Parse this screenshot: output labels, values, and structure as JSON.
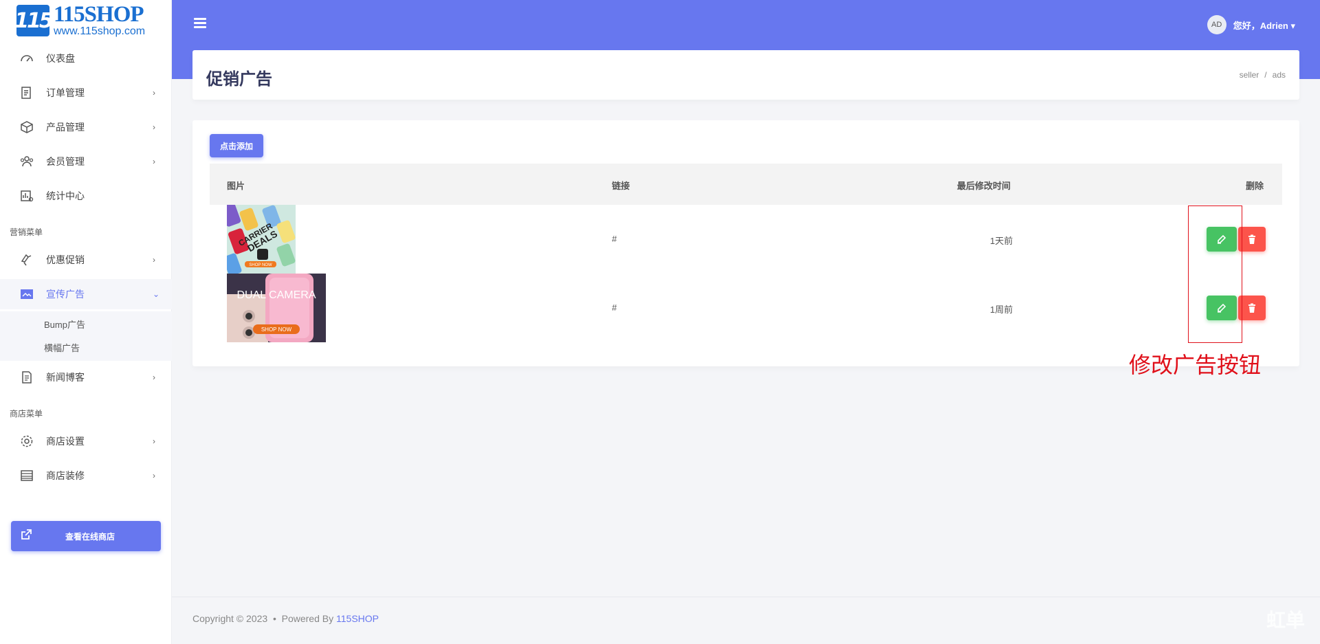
{
  "logo": {
    "name": "115SHOP",
    "url": "www.115shop.com",
    "mark": "115"
  },
  "sidebar": {
    "items": [
      {
        "label": "仪表盘",
        "icon": "dashboard-icon"
      },
      {
        "label": "订单管理",
        "icon": "orders-icon"
      },
      {
        "label": "产品管理",
        "icon": "products-icon"
      },
      {
        "label": "会员管理",
        "icon": "members-icon"
      },
      {
        "label": "统计中心",
        "icon": "stats-icon"
      },
      {
        "label": "优惠促销",
        "icon": "promotion-icon"
      },
      {
        "label": "宣传广告",
        "icon": "ads-icon"
      },
      {
        "label": "新闻博客",
        "icon": "news-icon"
      },
      {
        "label": "商店设置",
        "icon": "settings-icon"
      },
      {
        "label": "商店装修",
        "icon": "decoration-icon"
      }
    ],
    "sections": {
      "marketing": "营销菜单",
      "shop": "商店菜单"
    },
    "ads_sub": [
      "Bump广告",
      "横幅广告"
    ],
    "visit_store": "查看在线商店",
    "chevron": "›",
    "chevron_down": "⌄"
  },
  "header": {
    "avatar": "AD",
    "greeting": "您好，Adrien ▾"
  },
  "page": {
    "title": "促销广告",
    "breadcrumb": [
      "seller",
      "ads"
    ],
    "breadcrumb_sep": "/"
  },
  "table": {
    "add_button": "点击添加",
    "columns": [
      "图片",
      "链接",
      "最后修改时间",
      "删除"
    ],
    "rows": [
      {
        "link": "#",
        "modified": "1天前",
        "thumb_text": [
          "CARRIER",
          "DEALS"
        ],
        "thumb_cta": "SHOP NOW"
      },
      {
        "link": "#",
        "modified": "1周前",
        "thumb_text": [
          "DUAL CAMERA"
        ],
        "thumb_cta": "SHOP NOW"
      }
    ]
  },
  "annotation": {
    "label": "修改广告按钮"
  },
  "footer": {
    "copyright": "Copyright © 2023",
    "dot": "•",
    "powered_by": "Powered By",
    "brand": "115SHOP"
  },
  "watermark": "虹单"
}
